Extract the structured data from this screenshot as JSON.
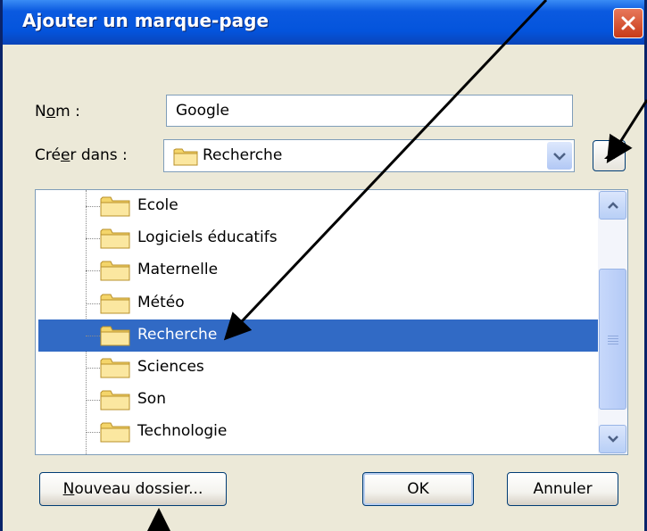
{
  "dialog": {
    "title": "Ajouter un marque-page",
    "name_label_pre": "N",
    "name_label_ul": "o",
    "name_label_post": "m :",
    "name_value": "Google",
    "create_label_pre": "Cré",
    "create_label_ul": "e",
    "create_label_post": "r dans :",
    "create_value": "Recherche"
  },
  "tree": {
    "items": [
      {
        "label": "Ecole"
      },
      {
        "label": "Logiciels éducatifs"
      },
      {
        "label": "Maternelle"
      },
      {
        "label": "Météo"
      },
      {
        "label": "Recherche"
      },
      {
        "label": "Sciences"
      },
      {
        "label": "Son"
      },
      {
        "label": "Technologie"
      }
    ],
    "selected_index": 4
  },
  "buttons": {
    "new_folder_ul": "N",
    "new_folder_rest": "ouveau dossier...",
    "ok": "OK",
    "cancel": "Annuler"
  },
  "colors": {
    "selection": "#316AC5",
    "titlebar": "#0454DC",
    "close": "#C83A19"
  },
  "icons": [
    "close-icon",
    "folder-icon",
    "chevron-down-icon",
    "chevron-up-icon",
    "annotation-arrow"
  ]
}
